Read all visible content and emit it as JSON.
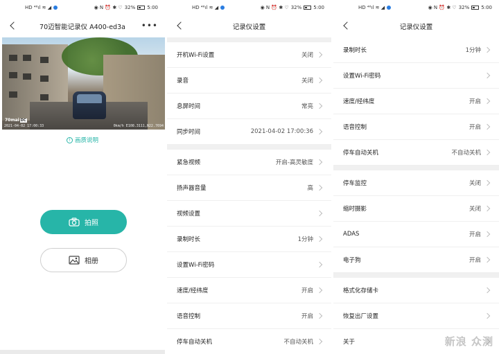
{
  "status": {
    "left_icons": "HD ⁴⁶ıl ≋ ◢",
    "right_icons": "◉ N ⏰ ✱ ♡",
    "battery": "32%",
    "time": "5:00"
  },
  "panel1": {
    "title": "70迈智能记录仪 A400-ed3a",
    "more": "•••",
    "camera_logo": "70mai",
    "camera_logo_badge": "DC",
    "camera_left_text": "2021-04-02 17:00:33",
    "camera_right_text": "0km/h E108.3111,N22.7694",
    "quality_link": "画质说明",
    "photo_button": "拍照",
    "album_button": "相册"
  },
  "panel2": {
    "title": "记录仪设置",
    "groups": [
      [
        {
          "label": "开机Wi-Fi设置",
          "value": "关闭"
        },
        {
          "label": "录音",
          "value": "关闭"
        },
        {
          "label": "息屏时间",
          "value": "常亮"
        },
        {
          "label": "同步时间",
          "value": "2021-04-02 17:00:36"
        }
      ],
      [
        {
          "label": "紧急视频",
          "value": "开启-高灵敏度"
        },
        {
          "label": "扬声器音量",
          "value": "高"
        },
        {
          "label": "视频设置",
          "value": ""
        },
        {
          "label": "录制时长",
          "value": "1分钟"
        },
        {
          "label": "设置Wi-Fi密码",
          "value": ""
        },
        {
          "label": "速度/经纬度",
          "value": "开启"
        },
        {
          "label": "语音控制",
          "value": "开启"
        },
        {
          "label": "停车自动关机",
          "value": "不自动关机"
        }
      ]
    ]
  },
  "panel3": {
    "title": "记录仪设置",
    "groups": [
      [
        {
          "label": "录制时长",
          "value": "1分钟"
        },
        {
          "label": "设置Wi-Fi密码",
          "value": ""
        },
        {
          "label": "速度/经纬度",
          "value": "开启"
        },
        {
          "label": "语音控制",
          "value": "开启"
        },
        {
          "label": "停车自动关机",
          "value": "不自动关机"
        }
      ],
      [
        {
          "label": "停车监控",
          "value": "关闭"
        },
        {
          "label": "缩时摄影",
          "value": "关闭"
        },
        {
          "label": "ADAS",
          "value": "开启"
        },
        {
          "label": "电子狗",
          "value": "开启"
        }
      ],
      [
        {
          "label": "格式化存储卡",
          "value": ""
        },
        {
          "label": "恢复出厂设置",
          "value": ""
        },
        {
          "label": "关于",
          "value": ""
        }
      ]
    ],
    "watermark": "新浪 众测"
  }
}
